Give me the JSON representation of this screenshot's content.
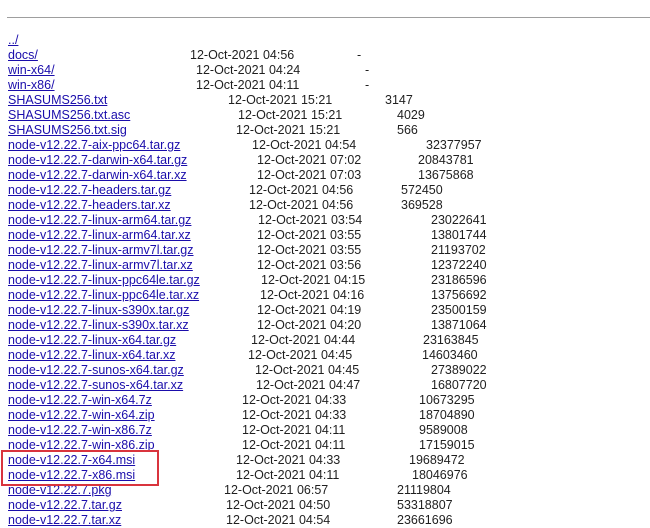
{
  "listing": {
    "parent_link": "../",
    "entries": [
      {
        "name": "docs/",
        "date": "12-Oct-2021 04:56",
        "size": "-"
      },
      {
        "name": "win-x64/",
        "date": "12-Oct-2021 04:24",
        "size": "-"
      },
      {
        "name": "win-x86/",
        "date": "12-Oct-2021 04:11",
        "size": "-"
      },
      {
        "name": "SHASUMS256.txt",
        "date": "12-Oct-2021 15:21",
        "size": "3147"
      },
      {
        "name": "SHASUMS256.txt.asc",
        "date": "12-Oct-2021 15:21",
        "size": "4029"
      },
      {
        "name": "SHASUMS256.txt.sig",
        "date": "12-Oct-2021 15:21",
        "size": "566"
      },
      {
        "name": "node-v12.22.7-aix-ppc64.tar.gz",
        "date": "12-Oct-2021 04:54",
        "size": "32377957"
      },
      {
        "name": "node-v12.22.7-darwin-x64.tar.gz",
        "date": "12-Oct-2021 07:02",
        "size": "20843781"
      },
      {
        "name": "node-v12.22.7-darwin-x64.tar.xz",
        "date": "12-Oct-2021 07:03",
        "size": "13675868"
      },
      {
        "name": "node-v12.22.7-headers.tar.gz",
        "date": "12-Oct-2021 04:56",
        "size": "572450"
      },
      {
        "name": "node-v12.22.7-headers.tar.xz",
        "date": "12-Oct-2021 04:56",
        "size": "369528"
      },
      {
        "name": "node-v12.22.7-linux-arm64.tar.gz",
        "date": "12-Oct-2021 03:54",
        "size": "23022641"
      },
      {
        "name": "node-v12.22.7-linux-arm64.tar.xz",
        "date": "12-Oct-2021 03:55",
        "size": "13801744"
      },
      {
        "name": "node-v12.22.7-linux-armv7l.tar.gz",
        "date": "12-Oct-2021 03:55",
        "size": "21193702"
      },
      {
        "name": "node-v12.22.7-linux-armv7l.tar.xz",
        "date": "12-Oct-2021 03:56",
        "size": "12372240"
      },
      {
        "name": "node-v12.22.7-linux-ppc64le.tar.gz",
        "date": "12-Oct-2021 04:15",
        "size": "23186596"
      },
      {
        "name": "node-v12.22.7-linux-ppc64le.tar.xz",
        "date": "12-Oct-2021 04:16",
        "size": "13756692"
      },
      {
        "name": "node-v12.22.7-linux-s390x.tar.gz",
        "date": "12-Oct-2021 04:19",
        "size": "23500159"
      },
      {
        "name": "node-v12.22.7-linux-s390x.tar.xz",
        "date": "12-Oct-2021 04:20",
        "size": "13871064"
      },
      {
        "name": "node-v12.22.7-linux-x64.tar.gz",
        "date": "12-Oct-2021 04:44",
        "size": "23163845"
      },
      {
        "name": "node-v12.22.7-linux-x64.tar.xz",
        "date": "12-Oct-2021 04:45",
        "size": "14603460"
      },
      {
        "name": "node-v12.22.7-sunos-x64.tar.gz",
        "date": "12-Oct-2021 04:45",
        "size": "27389022"
      },
      {
        "name": "node-v12.22.7-sunos-x64.tar.xz",
        "date": "12-Oct-2021 04:47",
        "size": "16807720"
      },
      {
        "name": "node-v12.22.7-win-x64.7z",
        "date": "12-Oct-2021 04:33",
        "size": "10673295"
      },
      {
        "name": "node-v12.22.7-win-x64.zip",
        "date": "12-Oct-2021 04:33",
        "size": "18704890"
      },
      {
        "name": "node-v12.22.7-win-x86.7z",
        "date": "12-Oct-2021 04:11",
        "size": "9589008"
      },
      {
        "name": "node-v12.22.7-win-x86.zip",
        "date": "12-Oct-2021 04:11",
        "size": "17159015"
      },
      {
        "name": "node-v12.22.7-x64.msi",
        "date": "12-Oct-2021 04:33",
        "size": "19689472"
      },
      {
        "name": "node-v12.22.7-x86.msi",
        "date": "12-Oct-2021 04:11",
        "size": "18046976"
      },
      {
        "name": "node-v12.22.7.pkg",
        "date": "12-Oct-2021 06:57",
        "size": "21119804"
      },
      {
        "name": "node-v12.22.7.tar.gz",
        "date": "12-Oct-2021 04:50",
        "size": "53318807"
      },
      {
        "name": "node-v12.22.7.tar.xz",
        "date": "12-Oct-2021 04:54",
        "size": "23661696"
      }
    ]
  },
  "colors": {
    "link": "#1a0dab",
    "text": "#1f1f1f",
    "rule": "#9e9e9e",
    "highlight": "#d9343d"
  }
}
